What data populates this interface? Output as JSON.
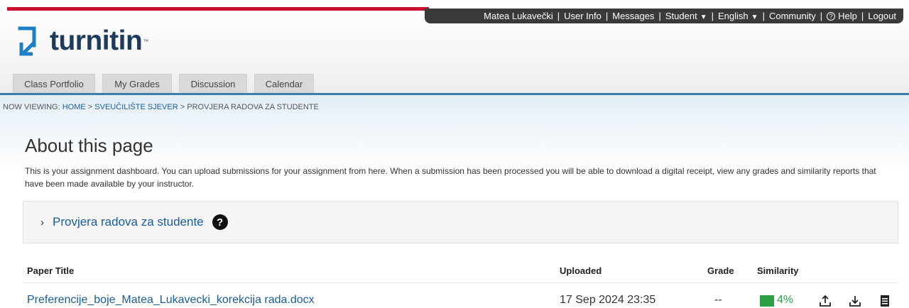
{
  "user_nav": {
    "user_name": "Matea Lukavečki",
    "user_info": "User Info",
    "messages": "Messages",
    "role": "Student",
    "language": "English",
    "community": "Community",
    "help": "Help",
    "logout": "Logout"
  },
  "logo": {
    "text": "turnitin",
    "tm": "™"
  },
  "tabs": [
    "Class Portfolio",
    "My Grades",
    "Discussion",
    "Calendar"
  ],
  "breadcrumb": {
    "prefix": "NOW VIEWING:",
    "home": "HOME",
    "course": "SVEUČILIŠTE SJEVER",
    "current": "PROVJERA RADOVA ZA STUDENTE",
    "separator": ">"
  },
  "page": {
    "title": "About this page",
    "description": "This is your assignment dashboard. You can upload submissions for your assignment from here. When a submission has been processed you will be able to download a digital receipt, view any grades and similarity reports that have been made available by your instructor."
  },
  "assignment": {
    "title": "Provjera radova za studente"
  },
  "table": {
    "headers": {
      "paper_title": "Paper Title",
      "uploaded": "Uploaded",
      "grade": "Grade",
      "similarity": "Similarity"
    },
    "rows": [
      {
        "paper_title": "Preferencije_boje_Matea_Lukavecki_korekcija rada.docx",
        "uploaded": "17 Sep 2024 23:35",
        "grade": "--",
        "similarity": "4%"
      }
    ]
  },
  "colors": {
    "brand_navy": "#1f3b5c",
    "link_blue": "#1a5c9a",
    "similarity_green": "#2ea043",
    "accent_red": "#c8102e"
  }
}
